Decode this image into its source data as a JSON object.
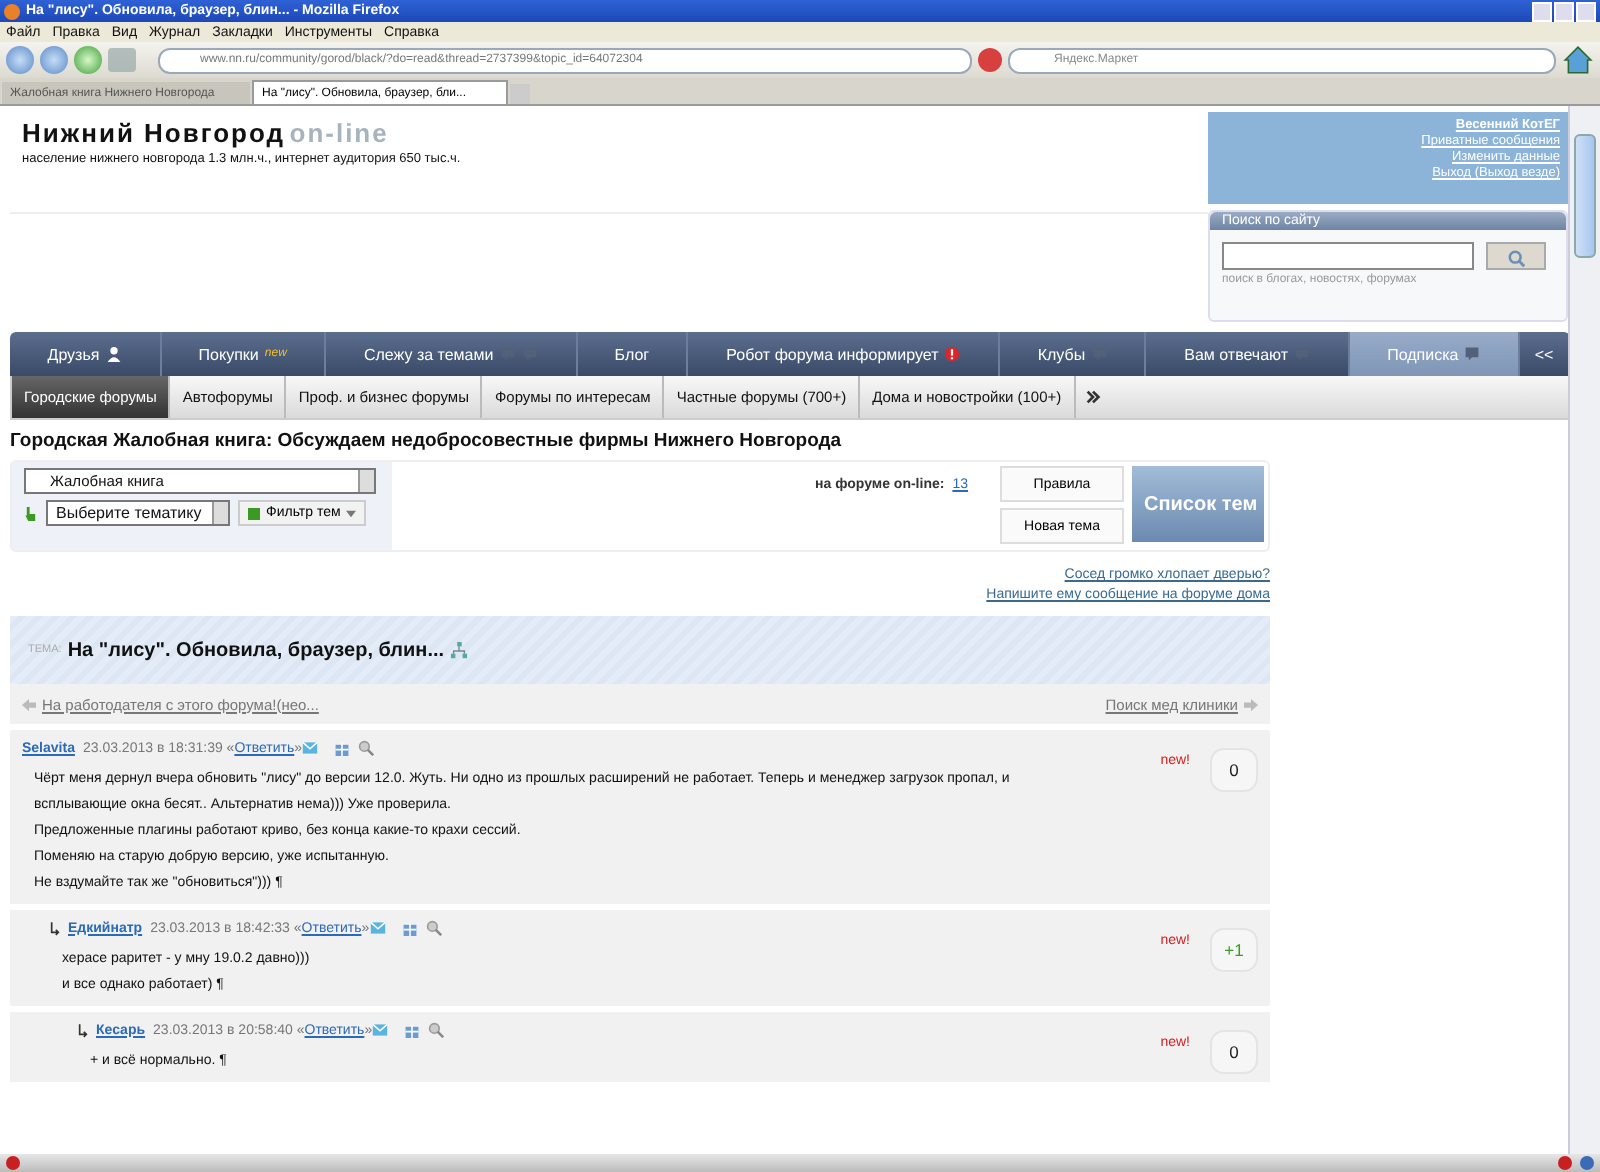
{
  "browser": {
    "title": "На \"лису\". Обновила, браузер, блин... - Mozilla Firefox",
    "menu": [
      "Файл",
      "Правка",
      "Вид",
      "Журнал",
      "Закладки",
      "Инструменты",
      "Справка"
    ],
    "url": "www.nn.ru/community/gorod/black/?do=read&thread=2737399&topic_id=64072304",
    "search_placeholder": "Яндекс.Маркет",
    "tabs": [
      {
        "label": "Жалобная книга Нижнего Новгорода",
        "selected": false
      },
      {
        "label": "На \"лису\". Обновила, браузер, бли...",
        "selected": true
      }
    ]
  },
  "site": {
    "logo": "Нижний Новгород",
    "logo_suffix": "on-line",
    "tagline": "население нижнего новгорода 1.3 млн.ч., интернет аудитория 650 тыс.ч."
  },
  "user_panel": {
    "name": "Весенний КотЕГ",
    "links": [
      "Приватные сообщения",
      "Изменить данные",
      "Выход (Выход везде)"
    ]
  },
  "site_search": {
    "title": "Поиск по сайту",
    "hint": "поиск в блогах, новостях, форумах"
  },
  "main_nav": [
    {
      "label": "Друзья",
      "kind": "person",
      "selected": false
    },
    {
      "label": "Покупки",
      "badge": "new",
      "kind": "plain",
      "selected": false
    },
    {
      "label": "Слежу за темами",
      "kind": "double",
      "selected": false
    },
    {
      "label": "Блог",
      "kind": "plain",
      "selected": false
    },
    {
      "label": "Робот форума информирует",
      "kind": "alert",
      "selected": false
    },
    {
      "label": "Клубы",
      "kind": "comment",
      "selected": false
    },
    {
      "label": "Вам отвечают",
      "kind": "comment",
      "selected": false
    },
    {
      "label": "Подписка",
      "kind": "comment",
      "selected": true
    },
    {
      "label": "<<",
      "kind": "plain",
      "selected": false
    }
  ],
  "sub_nav": [
    {
      "label": "Городские форумы",
      "selected": true
    },
    {
      "label": "Автофорумы",
      "selected": false
    },
    {
      "label": "Проф. и бизнес форумы",
      "selected": false
    },
    {
      "label": "Форумы по интересам",
      "selected": false
    },
    {
      "label": "Частные форумы (700+)",
      "selected": false
    },
    {
      "label": "Дома и новостройки (100+)",
      "selected": false
    }
  ],
  "forum_title": "Городская Жалобная книга: Обсуждаем недобросовестные фирмы Нижнего Новгорода",
  "toolbar": {
    "forum_select": "Жалобная книга",
    "topic_select": "Выберите тематику",
    "filter_button": "Фильтр тем",
    "online_label": "на форуме on-line:",
    "online_count": "13",
    "buttons": [
      "Правила",
      "Новая тема"
    ],
    "topic_list_button": "Список тем"
  },
  "ad_links": [
    "Сосед громко хлопает дверью?",
    "Напишите ему сообщение на форуме дома"
  ],
  "topic": {
    "label": "ТЕМА:",
    "title": "На \"лису\". Обновила, браузер, блин..."
  },
  "prev_topic": "На работодателя с этого форума!(нео...",
  "next_topic": "Поиск мед клиники",
  "posts": [
    {
      "author": "Selavita",
      "date": "23.03.2013 в 18:31:39 «",
      "reply": "Ответить",
      "reply_close": "»",
      "new": "new!",
      "score": "0",
      "color": "#222222",
      "body": [
        "Чёрт меня дернул вчера обновить \"лису\" до версии 12.0. Жуть. Ни одно из прошлых расширений не работает. Теперь и менеджер загрузок пропал, и всплывающие окна бесят.. Альтернатив нема))) Уже проверила.",
        "Предложенные плагины работают криво, без конца какие-то крахи сессий.",
        "Поменяю на старую добрую версию, уже испытанную.",
        "Не вздумайте так же \"обновиться\"))) ¶"
      ],
      "children": [
        {
          "author": "Едкийнатр",
          "date": "23.03.2013 в 18:42:33 «",
          "reply": "Ответить",
          "reply_close": "»",
          "new": "new!",
          "score": "+1",
          "color": "#3a9a22",
          "body": [
            "херасе раритет - у мну 19.0.2 давно)))",
            "и все однако работает) ¶"
          ],
          "children": [
            {
              "author": "Кесарь",
              "date": "23.03.2013 в 20:58:40 «",
              "reply": "Ответить",
              "reply_close": "»",
              "new": "new!",
              "score": "0",
              "color": "#222222",
              "body": [
                "+ и всё нормально. ¶"
              ]
            }
          ]
        }
      ]
    }
  ]
}
